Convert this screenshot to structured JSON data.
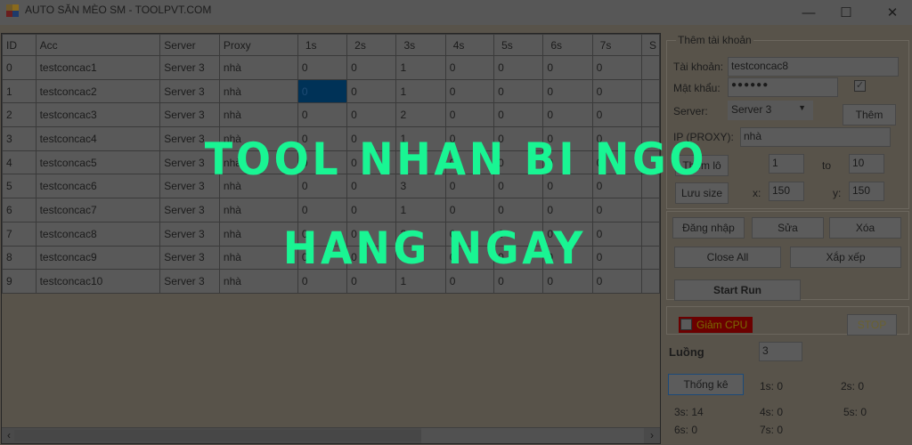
{
  "window": {
    "title": "AUTO SĂN MÈO SM - TOOLPVT.COM",
    "controls": {
      "minimize": "—",
      "maximize": "☐",
      "close": "✕"
    }
  },
  "grid": {
    "columns": [
      "ID",
      "Acc",
      "Server",
      "Proxy",
      "1s",
      "2s",
      "3s",
      "4s",
      "5s",
      "6s",
      "7s",
      "S"
    ],
    "rows": [
      [
        "0",
        "testconcac1",
        "Server 3",
        "nhà",
        "0",
        "0",
        "1",
        "0",
        "0",
        "0",
        "0",
        ""
      ],
      [
        "1",
        "testconcac2",
        "Server 3",
        "nhà",
        "0",
        "0",
        "1",
        "0",
        "0",
        "0",
        "0",
        ""
      ],
      [
        "2",
        "testconcac3",
        "Server 3",
        "nhà",
        "0",
        "0",
        "2",
        "0",
        "0",
        "0",
        "0",
        ""
      ],
      [
        "3",
        "testconcac4",
        "Server 3",
        "nhà",
        "0",
        "0",
        "1",
        "0",
        "0",
        "0",
        "0",
        ""
      ],
      [
        "4",
        "testconcac5",
        "Server 3",
        "nhà",
        "0",
        "0",
        "1",
        "0",
        "0",
        "0",
        "0",
        ""
      ],
      [
        "5",
        "testconcac6",
        "Server 3",
        "nhà",
        "0",
        "0",
        "3",
        "0",
        "0",
        "0",
        "0",
        ""
      ],
      [
        "6",
        "testconcac7",
        "Server 3",
        "nhà",
        "0",
        "0",
        "1",
        "0",
        "0",
        "0",
        "0",
        ""
      ],
      [
        "7",
        "testconcac8",
        "Server 3",
        "nhà",
        "0",
        "0",
        "2",
        "0",
        "0",
        "0",
        "0",
        ""
      ],
      [
        "8",
        "testconcac9",
        "Server 3",
        "nhà",
        "0",
        "0",
        "1",
        "0",
        "0",
        "0",
        "0",
        ""
      ],
      [
        "9",
        "testconcac10",
        "Server 3",
        "nhà",
        "0",
        "0",
        "1",
        "0",
        "0",
        "0",
        "0",
        ""
      ]
    ],
    "selected_cell": {
      "row": 1,
      "col": 4
    },
    "scroll": {
      "left_arrow": "‹",
      "right_arrow": "›"
    }
  },
  "add_account": {
    "group_title": "Thêm tài khoản",
    "account_label": "Tài khoản:",
    "account_value": "testconcac8",
    "password_label": "Mật khẩu:",
    "password_value": "●●●●●●",
    "show_password_checked": true,
    "server_label": "Server:",
    "server_value": "Server 3",
    "add_button": "Thêm",
    "proxy_label": "IP (PROXY):",
    "proxy_value": "nhà",
    "batch_add_button": "Thêm lô",
    "from_value": "1",
    "to_label": "to",
    "to_value": "10",
    "save_size_button": "Lưu size",
    "x_label": "x:",
    "x_value": "150",
    "y_label": "y:",
    "y_value": "150"
  },
  "actions": {
    "login": "Đăng nhập",
    "edit": "Sửa",
    "delete": "Xóa",
    "close_all": "Close All",
    "arrange": "Xắp xếp",
    "start_run": "Start Run"
  },
  "cpu": {
    "reduce_cpu_label": "Giảm CPU",
    "reduce_cpu_checked": false,
    "stop_button": "STOP"
  },
  "threads": {
    "label": "Luồng",
    "value": "3"
  },
  "stats": {
    "button": "Thống kê",
    "items": [
      "1s: 0",
      "2s: 0",
      "3s: 14",
      "4s: 0",
      "5s: 0",
      "6s: 0",
      "7s: 0"
    ]
  },
  "overlay": {
    "line1": "TOOL NHAN BI NGO",
    "line2": "HANG NGAY",
    "color": "#19f593"
  }
}
